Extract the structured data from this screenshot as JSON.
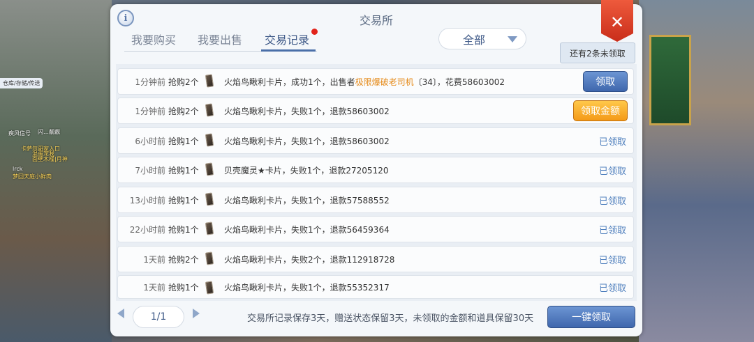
{
  "hud": {
    "tag": "仓库/存储/传送",
    "name1": "疾风信号",
    "name2": "闪…靓靓",
    "chat1": "卡萨尔哥家入口",
    "chat2": "混蛋宠我",
    "chat3": "面壁木槿|月神",
    "chat4": "lrck",
    "chat5": "梦回天庭小鲜肉"
  },
  "panel": {
    "title": "交易所",
    "info_icon": "i",
    "close_icon": "✕",
    "tabs": [
      "我要购买",
      "我要出售",
      "交易记录"
    ],
    "active_tab": 2,
    "filter": "全部",
    "unclaimed_tip": "还有2条未领取"
  },
  "records": [
    {
      "time": "1分钟前",
      "action": "抢购2个",
      "desc_pre": "火焰鸟瞅利卡片，成功1个，出售者",
      "seller": "极限爆破老司机",
      "desc_post": "〔34〕，花费58603002",
      "status": "领取",
      "status_type": "claim"
    },
    {
      "time": "1分钟前",
      "action": "抢购2个",
      "desc_pre": "火焰鸟瞅利卡片，失败1个，退款58603002",
      "seller": "",
      "desc_post": "",
      "status": "领取金额",
      "status_type": "claim-amount"
    },
    {
      "time": "6小时前",
      "action": "抢购1个",
      "desc_pre": "火焰鸟瞅利卡片，失败1个，退款58603002",
      "seller": "",
      "desc_post": "",
      "status": "已领取",
      "status_type": "claimed"
    },
    {
      "time": "7小时前",
      "action": "抢购1个",
      "desc_pre": "贝壳魔灵★卡片，失败1个，退款27205120",
      "seller": "",
      "desc_post": "",
      "status": "已领取",
      "status_type": "claimed"
    },
    {
      "time": "13小时前",
      "action": "抢购1个",
      "desc_pre": "火焰鸟瞅利卡片，失败1个，退款57588552",
      "seller": "",
      "desc_post": "",
      "status": "已领取",
      "status_type": "claimed"
    },
    {
      "time": "22小时前",
      "action": "抢购1个",
      "desc_pre": "火焰鸟瞅利卡片，失败1个，退款56459364",
      "seller": "",
      "desc_post": "",
      "status": "已领取",
      "status_type": "claimed"
    },
    {
      "time": "1天前",
      "action": "抢购2个",
      "desc_pre": "火焰鸟瞅利卡片，失败2个，退款112918728",
      "seller": "",
      "desc_post": "",
      "status": "已领取",
      "status_type": "claimed"
    },
    {
      "time": "1天前",
      "action": "抢购1个",
      "desc_pre": "火焰鸟瞅利卡片，失败1个，退款55352317",
      "seller": "",
      "desc_post": "",
      "status": "已领取",
      "status_type": "claimed"
    }
  ],
  "footer": {
    "page": "1/1",
    "note": "交易所记录保存3天，赠送状态保留3天，未领取的金额和道具保留30天",
    "claim_all": "一键领取"
  }
}
